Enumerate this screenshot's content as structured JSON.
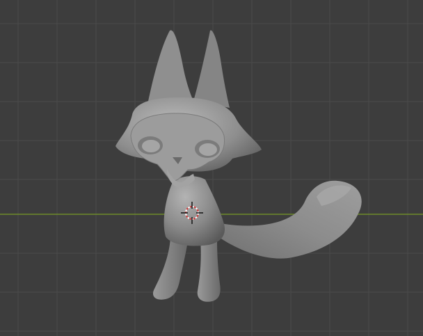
{
  "viewport": {
    "type": "3d-viewport",
    "background_color": "#3d3d3d",
    "grid_color": "#4a4a4a",
    "x_axis_color": "#6e8c2a",
    "mesh_color": "#8a8a8a"
  },
  "scene": {
    "object": "cat-sculpt",
    "icons": {
      "cursor": "3d-cursor-icon"
    }
  }
}
